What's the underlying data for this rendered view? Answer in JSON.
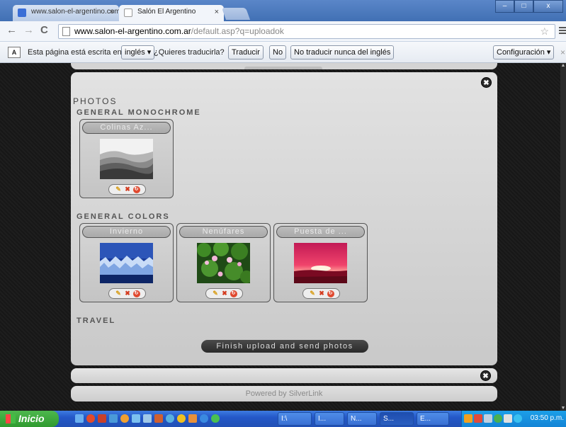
{
  "browser": {
    "tabs": [
      {
        "label": "www.salon-el-argentino.com",
        "close": "×"
      },
      {
        "label": "Salón El Argentino",
        "close": "×"
      }
    ],
    "window_buttons": [
      "–",
      "□",
      "x"
    ]
  },
  "toolbar": {
    "back": "←",
    "forward": "→",
    "reload": "C",
    "url_domain": "www.salon-el-argentino.com.ar",
    "url_path": "/default.asp?q=uploadok",
    "star": "☆"
  },
  "translate_bar": {
    "icon_text": "A",
    "prefix": "Esta página está escrita en",
    "language": "inglés ▾",
    "question": "¿Quieres traducirla?",
    "translate": "Traducir",
    "no": "No",
    "never": "No traducir nunca del inglés",
    "settings": "Configuración ▾",
    "close": "×"
  },
  "page": {
    "heading": "PHOTOS",
    "close_symbol": "✖",
    "albums": [
      {
        "title": "GENERAL MONOCHROME",
        "photos": [
          {
            "name": "Colinas Az...",
            "theme": "monochrome"
          }
        ]
      },
      {
        "title": "GENERAL COLORS",
        "photos": [
          {
            "name": "Invierno",
            "theme": "winter"
          },
          {
            "name": "Nenúfares",
            "theme": "waterlily"
          },
          {
            "name": "Puesta de ...",
            "theme": "sunset"
          }
        ]
      },
      {
        "title": "TRAVEL",
        "photos": []
      }
    ],
    "action_icons": {
      "edit": "✎",
      "delete": "✖",
      "rotate": "↻"
    },
    "finish_button": "Finish upload and send photos",
    "footer": "Powered by SilverLink"
  },
  "taskbar": {
    "start": "Inicio",
    "tasks": [
      "I:\\",
      "I...",
      "N...",
      "S...",
      "E..."
    ],
    "clock": "03:50 p.m."
  },
  "colors": {
    "titlebar": "#4170b4",
    "page_background": "#1a1a1a",
    "panel": "#d2d2d2",
    "finish_button": "#333333",
    "taskbar": "#2458c8",
    "start_button": "#3aa53a"
  }
}
